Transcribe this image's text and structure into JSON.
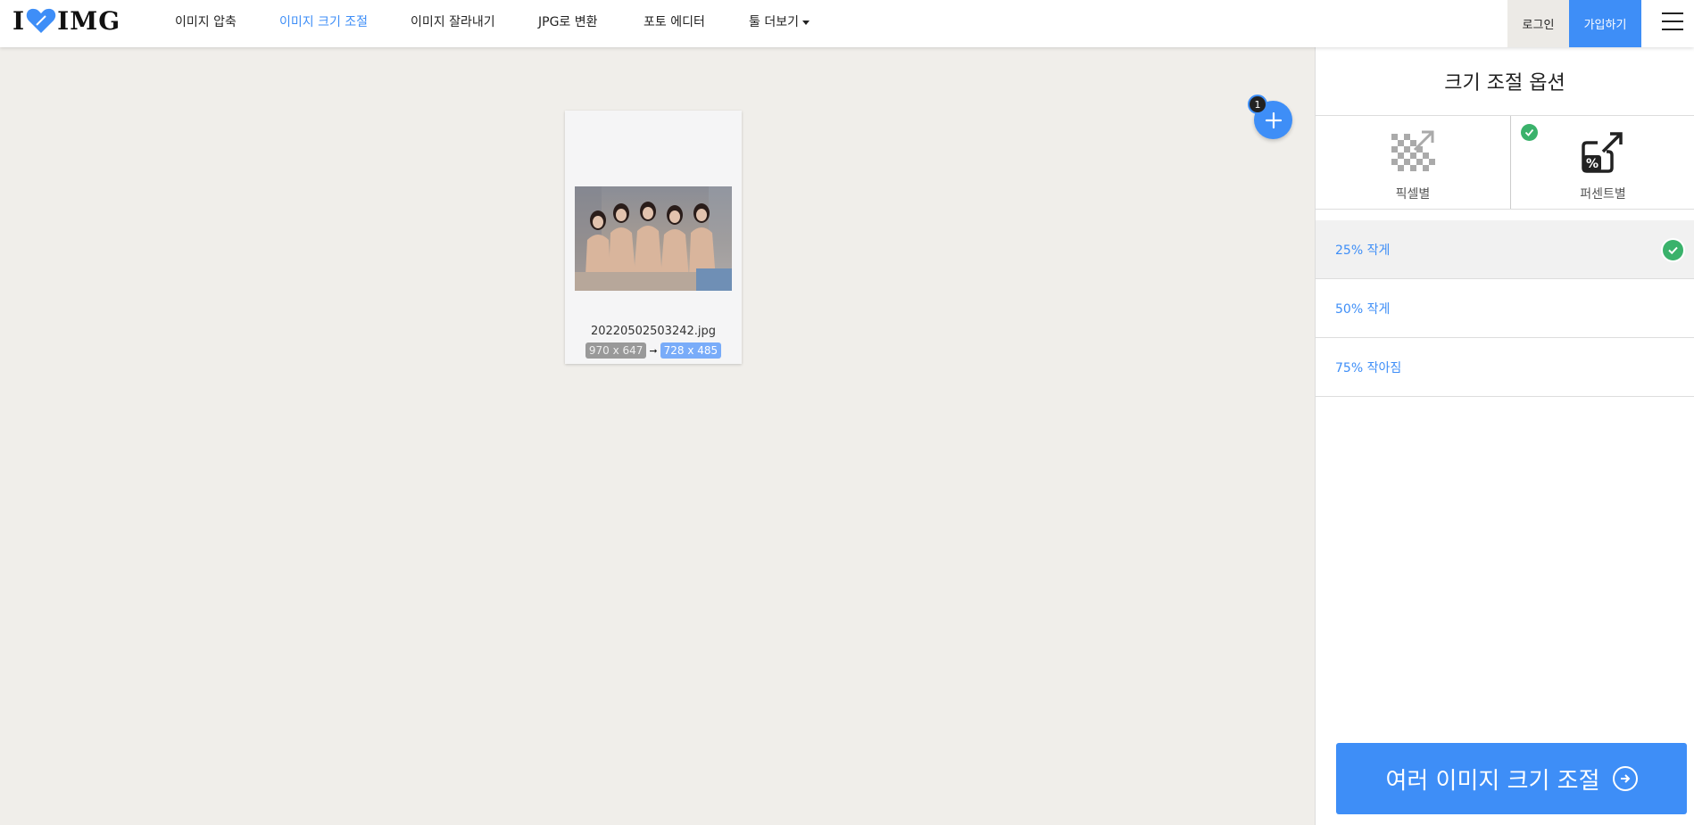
{
  "header": {
    "logo": {
      "left": "I",
      "right": "IMG",
      "heart_color": "#3e8ef7"
    },
    "nav": [
      {
        "label": "이미지 압축"
      },
      {
        "label": "이미지 크기 조절"
      },
      {
        "label": "이미지 잘라내기"
      },
      {
        "label": "JPG로 변환"
      },
      {
        "label": "포토 에디터"
      },
      {
        "label": "툴 더보기"
      }
    ],
    "login_label": "로그인",
    "signup_label": "가입하기"
  },
  "workspace": {
    "file": {
      "name": "20220502503242.jpg",
      "original_dims": "970 x 647",
      "new_dims": "728 x 485"
    },
    "file_count": "1"
  },
  "sidebar": {
    "title": "크기 조절 옵션",
    "modes": [
      {
        "label": "픽셀별",
        "icon": "pixel-resize-icon",
        "selected": false
      },
      {
        "label": "퍼센트별",
        "icon": "percent-resize-icon",
        "selected": true
      }
    ],
    "options": [
      {
        "label": "25% 작게",
        "selected": true
      },
      {
        "label": "50% 작게",
        "selected": false
      },
      {
        "label": "75% 작아짐",
        "selected": false
      }
    ],
    "submit_label": "여러 이미지 크기 조절"
  },
  "colors": {
    "accent": "#3e8ef7",
    "success": "#3ab26b",
    "workspace_bg": "#f0eeea"
  }
}
